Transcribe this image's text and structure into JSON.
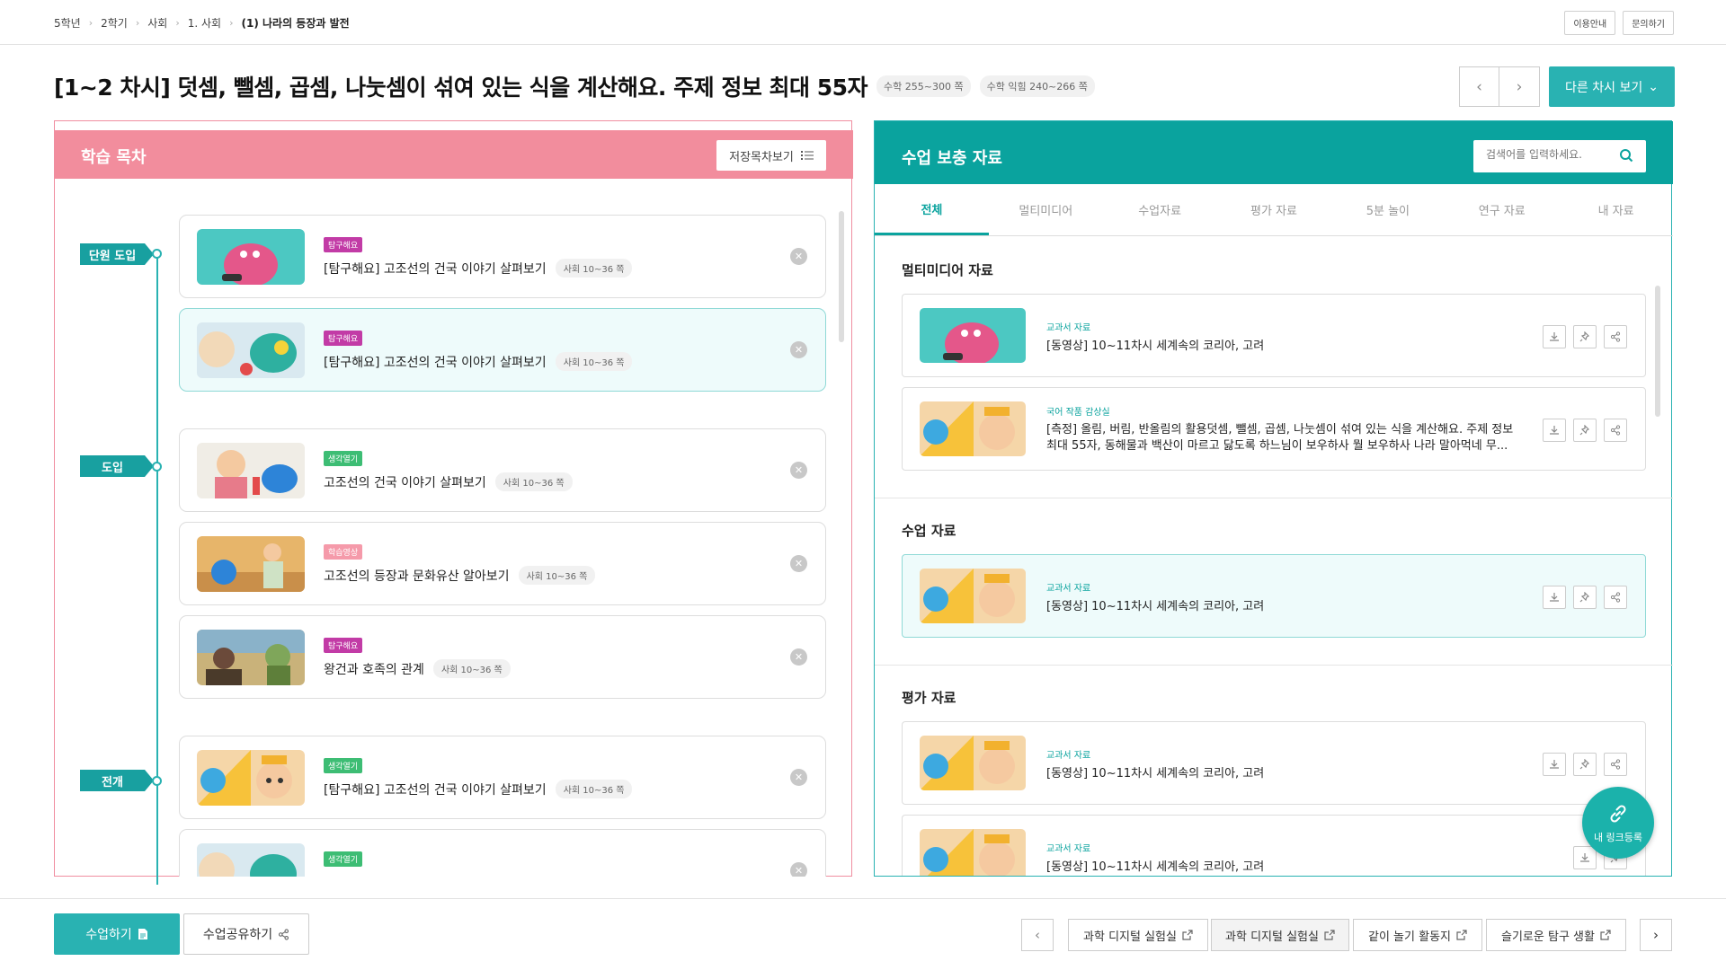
{
  "breadcrumb": [
    "5학년",
    "2학기",
    "사회",
    "1. 사회",
    "(1) 나라의 등장과 발전"
  ],
  "topbar": {
    "guide": "이용안내",
    "inquiry": "문의하기"
  },
  "title": {
    "text": "[1~2 차시] 덧셈, 뺄셈, 곱셈, 나눗셈이 섞여 있는 식을 계산해요. 주제 정보 최대 55자",
    "tag1": "수학 255~300 쪽",
    "tag2": "수학 익힘 240~266 쪽"
  },
  "nav": {
    "prev_icon": "chevron-left-icon",
    "next_icon": "chevron-right-icon",
    "other_label": "다른 차시 보기"
  },
  "left": {
    "title": "학습 목차",
    "save_label": "저장목차보기",
    "stages": [
      "단원 도입",
      "도입",
      "전개"
    ],
    "cards": [
      {
        "badge": "탐구해요",
        "badge_color": "#c23ba6",
        "name": "[탐구해요] 고조선의 건국 이야기 살펴보기",
        "page": "사회 10~36 쪽"
      },
      {
        "badge": "탐구해요",
        "badge_color": "#c23ba6",
        "name": "[탐구해요] 고조선의 건국 이야기 살펴보기",
        "page": "사회 10~36 쪽"
      },
      {
        "badge": "생각열기",
        "badge_color": "#3dbd74",
        "name": "고조선의 건국 이야기 살펴보기",
        "page": "사회 10~36 쪽"
      },
      {
        "badge": "학습영상",
        "badge_color": "#f59aaa",
        "name": "고조선의 등장과 문화유산 알아보기",
        "page": "사회 10~36 쪽"
      },
      {
        "badge": "탐구해요",
        "badge_color": "#c23ba6",
        "name": "왕건과 호족의 관계",
        "page": "사회 10~36 쪽"
      },
      {
        "badge": "생각열기",
        "badge_color": "#3dbd74",
        "name": "[탐구해요] 고조선의 건국 이야기 살펴보기",
        "page": "사회 10~36 쪽"
      },
      {
        "badge": "생각열기",
        "badge_color": "#3dbd74",
        "name": "",
        "page": ""
      }
    ]
  },
  "right": {
    "title": "수업 보충 자료",
    "search_placeholder": "검색어를 입력하세요.",
    "tabs": [
      "전체",
      "멀티미디어",
      "수업자료",
      "평가 자료",
      "5분 놀이",
      "연구 자료",
      "내 자료"
    ],
    "sections": {
      "multimedia": "멀티미디어 자료",
      "class": "수업 자료",
      "eval": "평가 자료"
    },
    "items": [
      {
        "category": "교과서 자료",
        "title": "[동영상] 10~11차시 세계속의 코리아, 고려"
      },
      {
        "category": "국어 작품 감상실",
        "title": "[측정] 올림, 버림, 반올림의 활용덧셈, 뺄셈, 곱셈, 나눗셈이 섞여 있는 식을 계산해요. 주제 정보 최대 55자, 동해물과 백산이 마르고 닳도록 하느님이 보우하사 뭘 보우하사 나라 말아먹네 무..."
      },
      {
        "category": "교과서 자료",
        "title": "[동영상] 10~11차시 세계속의 코리아, 고려"
      },
      {
        "category": "교과서 자료",
        "title": "[동영상] 10~11차시 세계속의 코리아, 고려"
      },
      {
        "category": "교과서 자료",
        "title": "[동영상] 10~11차시 세계속의 코리아, 고려"
      }
    ],
    "fab_label": "내 링크등록"
  },
  "bottom": {
    "start_label": "수업하기",
    "share_label": "수업공유하기",
    "links": [
      "과학 디지털 실험실",
      "과학 디지털 실험실",
      "같이 놀기 활동지",
      "슬기로운 탐구 생활"
    ]
  },
  "colors": {
    "accent": "#29b2b2",
    "pink": "#f28d9d",
    "teal_dark": "#0aa39e"
  }
}
